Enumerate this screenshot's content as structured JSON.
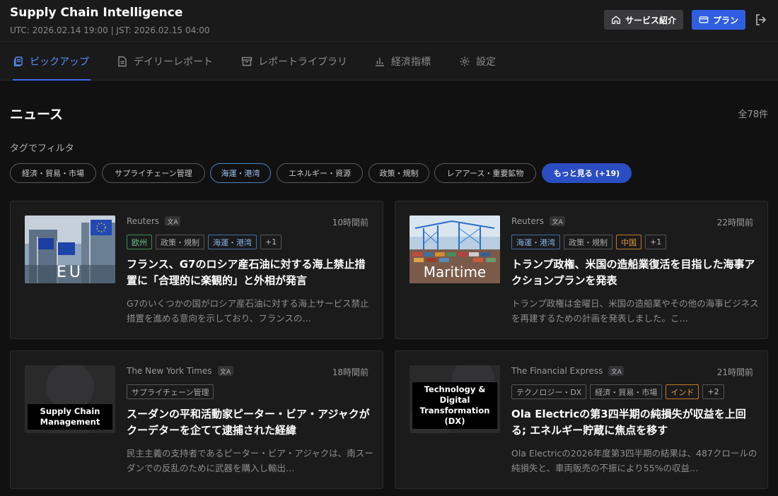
{
  "header": {
    "title": "Supply Chain Intelligence",
    "timestamp": "UTC: 2026.02.14 19:00 | JST: 2026.02.15 04:00",
    "service_btn": "サービス紹介",
    "plan_btn": "プラン",
    "icons": {
      "service": "home-icon",
      "plan": "card-icon",
      "logout": "logout-icon"
    }
  },
  "tabs": [
    {
      "label": "ピックアップ",
      "icon": "pickup-icon",
      "active": true
    },
    {
      "label": "デイリーレポート",
      "icon": "document-icon"
    },
    {
      "label": "レポートライブラリ",
      "icon": "archive-icon"
    },
    {
      "label": "経済指標",
      "icon": "bar-chart-icon"
    },
    {
      "label": "設定",
      "icon": "gear-icon"
    }
  ],
  "news": {
    "title": "ニュース",
    "total": "全78件",
    "filter_label": "タグでフィルタ"
  },
  "chips": [
    {
      "label": "経済・貿易・市場"
    },
    {
      "label": "サプライチェーン管理"
    },
    {
      "label": "海運・港湾",
      "selected": true
    },
    {
      "label": "エネルギー・資源"
    },
    {
      "label": "政策・規制"
    },
    {
      "label": "レアアース・重要鉱物"
    },
    {
      "label": "もっと見る (+19)"
    }
  ],
  "articles": [
    {
      "source": "Reuters",
      "time": "10時間前",
      "tags": [
        "欧州",
        "政策・規制",
        "海運・港湾",
        "+1"
      ],
      "headline": "フランス、G7のロシア産石油に対する海上禁止措置に「合理的に楽観的」と外相が発言",
      "summary": "G7のいくつかの国がロシア産石油に対する海上サービス禁止措置を進める意向を示しており、フランスの…",
      "thumb_text": "EU"
    },
    {
      "source": "Reuters",
      "time": "22時間前",
      "tags": [
        "海運・港湾",
        "政策・規制",
        "中国",
        "+1"
      ],
      "headline": "トランプ政権、米国の造船業復活を目指した海事アクションプランを発表",
      "summary": "トランプ政権は金曜日、米国の造船業やその他の海事ビジネスを再建するための計画を発表しました。こ…",
      "thumb_text": "Maritime"
    },
    {
      "source": "The New York Times",
      "time": "18時間前",
      "tags": [
        "サプライチェーン管理"
      ],
      "headline": "スーダンの平和活動家ピーター・ビア・アジャクがクーデターを企てて逮捕された経緯",
      "summary": "民主主義の支持者であるピーター・ビア・アジャクは、南スーダンでの反乱のために武器を購入し輸出…",
      "thumb_text": "Supply Chain Management"
    },
    {
      "source": "The Financial Express",
      "time": "21時間前",
      "tags": [
        "テクノロジー・DX",
        "経済・貿易・市場",
        "インド",
        "+2"
      ],
      "headline": "Ola Electricの第3四半期の純損失が収益を上回る; エネルギー貯蔵に焦点を移す",
      "summary": "Ola Electricの2026年度第3四半期の結果は、487クロールの純損失と、車両販売の不振により55%の収益…",
      "thumb_text": "Technology & Digital Transformation (DX)"
    }
  ],
  "colors": {
    "accent": "#2f5fe0",
    "background": "#111112",
    "card": "#1b1b1c"
  }
}
